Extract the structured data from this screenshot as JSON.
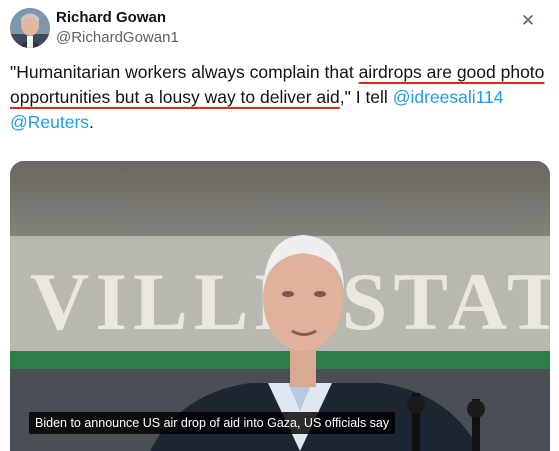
{
  "author": {
    "display_name": "Richard Gowan",
    "handle": "@RichardGowan1"
  },
  "icons": {
    "close": "close-icon",
    "avatar": "avatar-photo"
  },
  "tweet": {
    "text_before": "\"Humanitarian workers always complain that ",
    "highlight_1": "airdrops are good photo",
    "highlight_2": "opportunities but a lousy way to deliver aid",
    "text_middle": ",\" I tell ",
    "mention_1": "@idreesali114",
    "mention_2": "@Reuters",
    "text_end": "."
  },
  "media": {
    "caption": "Biden to announce US air drop of aid into Gaza, US officials say",
    "sign_text": "VILLE STAT"
  },
  "colors": {
    "mention": "#1d9bf0",
    "underline": "#e0261c",
    "secondary_text": "#536471"
  }
}
